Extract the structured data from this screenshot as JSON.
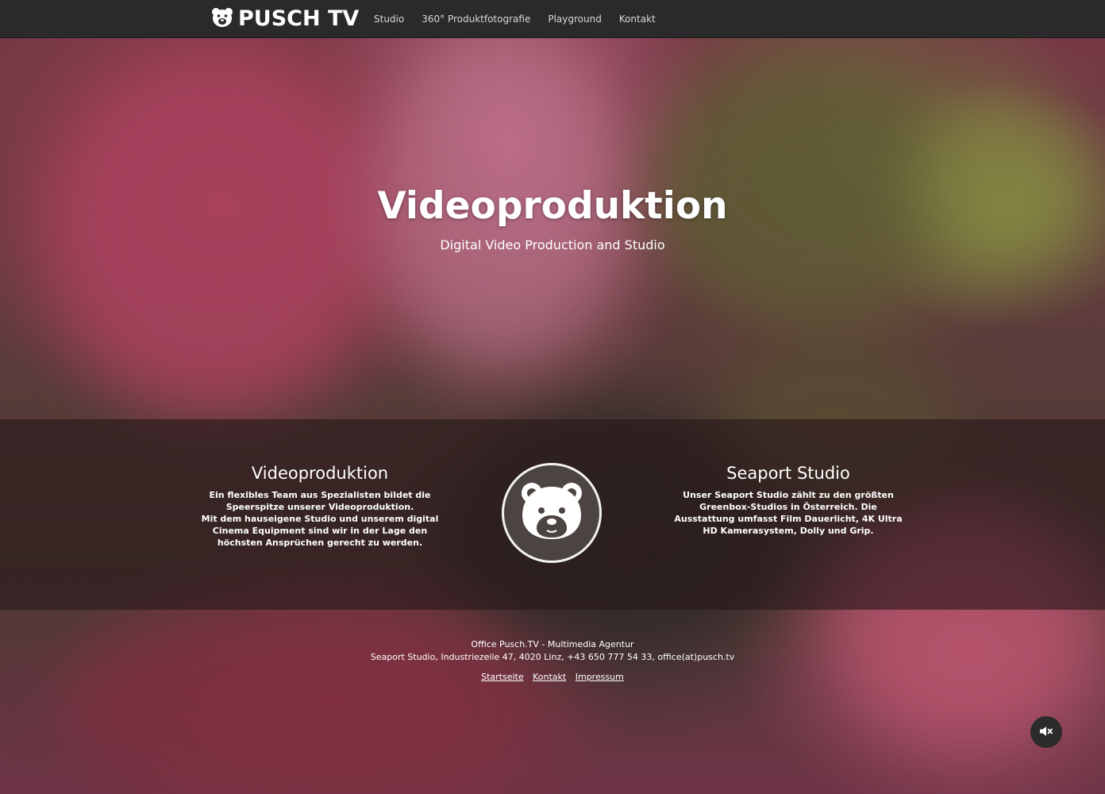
{
  "header": {
    "logo_text": "PUSCH TV",
    "logo_icon": "bear-icon",
    "nav": [
      {
        "label": "Studio"
      },
      {
        "label": "360° Produktfotografie"
      },
      {
        "label": "Playground"
      },
      {
        "label": "Kontakt"
      }
    ]
  },
  "hero": {
    "title": "Videoproduktion",
    "subtitle": "Digital Video Production and Studio"
  },
  "features": {
    "left": {
      "title": "Videoproduktion",
      "text": "Ein flexibles Team aus Spezialisten bildet die Speerspitze unserer Videoproduktion.\nMit dem hauseigene Studio und unserem digital Cinema Equipment sind wir in der Lage den höchsten Ansprüchen gerecht zu werden."
    },
    "center_icon": "bear-icon",
    "right": {
      "title": "Seaport Studio",
      "text": "Unser Seaport Studio zählt zu den größten Greenbox-Studios in Österreich. Die Ausstattung umfasst Film Dauerlicht, 4K Ultra HD Kamerasystem, Dolly und Grip."
    }
  },
  "footer": {
    "company": "Office Pusch.TV - Multimedia Agentur",
    "address": "Seaport Studio, Industriezeile 47, 4020 Linz, +43 650 777 54 33, office(at)pusch.tv",
    "links": [
      {
        "label": "Startseite"
      },
      {
        "label": "Kontakt"
      },
      {
        "label": "Impressum"
      }
    ]
  },
  "controls": {
    "mute_icon": "volume-mute-icon"
  },
  "colors": {
    "topbar": "#2a2a2a",
    "band": "rgba(40,24,26,0.62)",
    "text": "#ffffff"
  }
}
